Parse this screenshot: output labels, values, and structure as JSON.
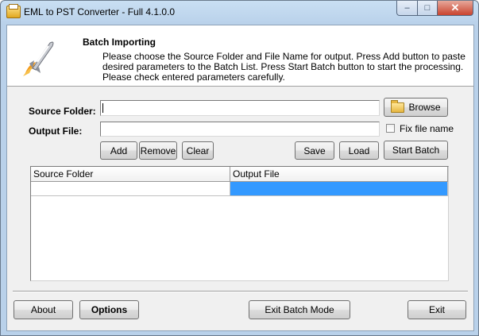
{
  "window": {
    "title": "EML to PST Converter - Full 4.1.0.0",
    "minimize_label": "–",
    "maximize_label": "□",
    "close_label": "✕"
  },
  "header": {
    "title": "Batch Importing",
    "description_lines": [
      "Please choose the Source Folder and File Name for output. Press Add button to paste",
      "desired parameters to the Batch List. Press Start Batch button to start the processing.",
      "Please check entered parameters carefully."
    ]
  },
  "form": {
    "source_folder_label": "Source Folder:",
    "source_folder_value": "",
    "output_file_label": "Output File:",
    "output_file_value": "",
    "browse_label": "Browse",
    "fix_file_name_label": "Fix file name",
    "fix_file_name_checked": false
  },
  "actions": {
    "add": "Add",
    "remove": "Remove",
    "clear": "Clear",
    "save": "Save",
    "load": "Load",
    "start_batch": "Start Batch"
  },
  "batch_list": {
    "columns": [
      "Source Folder",
      "Output File"
    ],
    "rows": [
      {
        "source_folder": "",
        "output_file": ""
      }
    ]
  },
  "footer": {
    "about": "About",
    "options": "Options",
    "exit_batch_mode": "Exit Batch Mode",
    "exit": "Exit"
  },
  "icons": {
    "app": "app-icon",
    "header": "rocket-icon",
    "browse": "folder-icon"
  }
}
